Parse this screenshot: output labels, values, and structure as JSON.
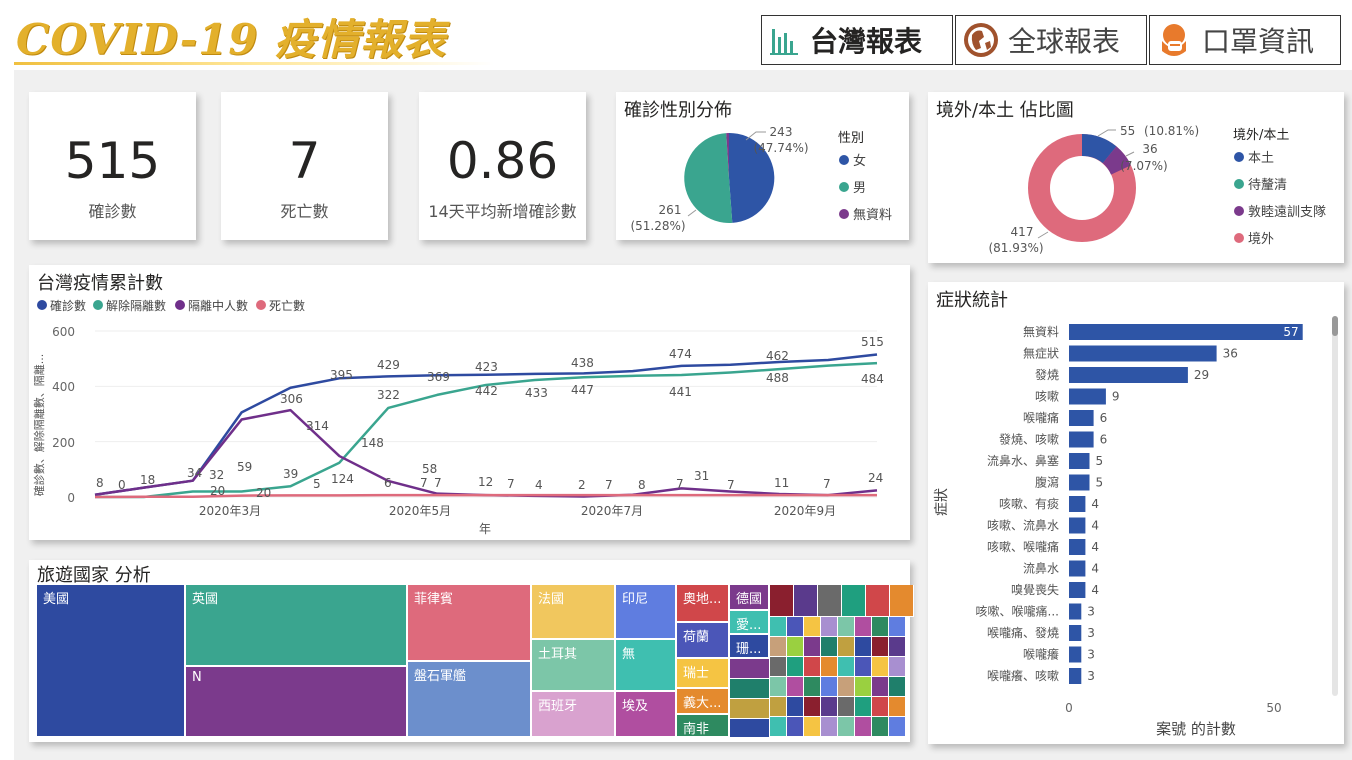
{
  "header": {
    "title": "COVID-19 疫情報表",
    "nav": [
      {
        "label": "台灣報表",
        "icon": "bar-chart-icon"
      },
      {
        "label": "全球報表",
        "icon": "globe-icon"
      },
      {
        "label": "口罩資訊",
        "icon": "mask-icon"
      }
    ]
  },
  "kpis": [
    {
      "value": "515",
      "label": "確診數"
    },
    {
      "value": "7",
      "label": "死亡數"
    },
    {
      "value": "0.86",
      "label": "14天平均新增確診數"
    }
  ],
  "gender_pie": {
    "title": "確診性別分佈",
    "legend_title": "性別",
    "legend": [
      {
        "name": "女",
        "color": "#2e55a6"
      },
      {
        "name": "男",
        "color": "#3aa58f"
      },
      {
        "name": "無資料",
        "color": "#7b3a8c"
      }
    ],
    "labels": [
      {
        "count": "243",
        "pct": "(47.74%)"
      },
      {
        "count": "261",
        "pct": "(51.28%)"
      }
    ]
  },
  "source_donut": {
    "title": "境外/本土 佔比圖",
    "legend_title": "境外/本土",
    "legend": [
      {
        "name": "本土",
        "color": "#2e55a6"
      },
      {
        "name": "待釐清",
        "color": "#3aa58f"
      },
      {
        "name": "敦睦遠訓支隊",
        "color": "#7b3a8c"
      },
      {
        "name": "境外",
        "color": "#de6a7c"
      }
    ],
    "labels": [
      {
        "count": "55",
        "pct": "(10.81%)"
      },
      {
        "count": "36",
        "pct": "(7.07%)"
      },
      {
        "count": "417",
        "pct": "(81.93%)"
      }
    ]
  },
  "line_chart": {
    "title": "台灣疫情累計數",
    "legend": [
      {
        "name": "確診數",
        "color": "#2e4aa0"
      },
      {
        "name": "解除隔離數",
        "color": "#3aa58f"
      },
      {
        "name": "隔離中人數",
        "color": "#6f2f8a"
      },
      {
        "name": "死亡數",
        "color": "#de6a7c"
      }
    ],
    "ylabel": "確診數、解除隔離數、隔離...",
    "xlabel": "年",
    "yticks": [
      "600",
      "400",
      "200",
      "0"
    ],
    "xticks": [
      "2020年3月",
      "2020年5月",
      "2020年7月",
      "2020年9月"
    ],
    "data_labels": [
      "8",
      "0",
      "18",
      "34",
      "32",
      "20",
      "59",
      "20",
      "306",
      "314",
      "39",
      "5",
      "395",
      "124",
      "322",
      "148",
      "429",
      "6",
      "7",
      "7",
      "58",
      "369",
      "423",
      "442",
      "12",
      "7",
      "433",
      "4",
      "438",
      "447",
      "2",
      "7",
      "8",
      "474",
      "441",
      "7",
      "31",
      "7",
      "462",
      "488",
      "11",
      "7",
      "515",
      "484",
      "24"
    ]
  },
  "chart_data": {
    "type": "line",
    "title": "台灣疫情累計數",
    "xlabel": "年",
    "ylabel": "確診數、解除隔離數、隔離...",
    "x": [
      "2020-01",
      "2020-02",
      "2020-03-01",
      "2020-03-15",
      "2020-04-01",
      "2020-04-15",
      "2020-05-01",
      "2020-05-15",
      "2020-06-01",
      "2020-06-15",
      "2020-07-01",
      "2020-07-15",
      "2020-08-01",
      "2020-08-15",
      "2020-09-01",
      "2020-09-15",
      "2020-10-01"
    ],
    "ylim": [
      0,
      600
    ],
    "series": [
      {
        "name": "確診數",
        "values": [
          8,
          34,
          59,
          306,
          395,
          429,
          436,
          440,
          442,
          445,
          447,
          455,
          474,
          478,
          488,
          495,
          515
        ]
      },
      {
        "name": "解除隔離數",
        "values": [
          0,
          0,
          20,
          20,
          39,
          124,
          322,
          369,
          405,
          423,
          433,
          438,
          441,
          450,
          462,
          475,
          484
        ]
      },
      {
        "name": "隔離中人數",
        "values": [
          8,
          34,
          59,
          280,
          314,
          148,
          58,
          12,
          7,
          4,
          2,
          8,
          31,
          20,
          11,
          7,
          24
        ]
      },
      {
        "name": "死亡數",
        "values": [
          0,
          1,
          1,
          5,
          6,
          6,
          7,
          7,
          7,
          7,
          7,
          7,
          7,
          7,
          7,
          7,
          7
        ]
      }
    ]
  },
  "symptoms": {
    "title": "症狀統計",
    "ylabel": "症狀",
    "xlabel": "案號 的計數",
    "xticks": [
      "0",
      "50"
    ],
    "items": [
      {
        "name": "無資料",
        "value": 57
      },
      {
        "name": "無症狀",
        "value": 36
      },
      {
        "name": "發燒",
        "value": 29
      },
      {
        "name": "咳嗽",
        "value": 9
      },
      {
        "name": "喉嚨痛",
        "value": 6
      },
      {
        "name": "發燒、咳嗽",
        "value": 6
      },
      {
        "name": "流鼻水、鼻塞",
        "value": 5
      },
      {
        "name": "腹瀉",
        "value": 5
      },
      {
        "name": "咳嗽、有痰",
        "value": 4
      },
      {
        "name": "咳嗽、流鼻水",
        "value": 4
      },
      {
        "name": "咳嗽、喉嚨痛",
        "value": 4
      },
      {
        "name": "流鼻水",
        "value": 4
      },
      {
        "name": "嗅覺喪失",
        "value": 4
      },
      {
        "name": "咳嗽、喉嚨痛...",
        "value": 3
      },
      {
        "name": "喉嚨痛、發燒",
        "value": 3
      },
      {
        "name": "喉嚨癢",
        "value": 3
      },
      {
        "name": "喉嚨癢、咳嗽",
        "value": 3
      }
    ]
  },
  "treemap": {
    "title": "旅遊國家 分析",
    "labels": [
      "美國",
      "英國",
      "N",
      "菲律賓",
      "盤石軍艦",
      "法國",
      "土耳其",
      "西班牙",
      "印尼",
      "無",
      "埃及",
      "奧地...",
      "荷蘭",
      "瑞士",
      "義大...",
      "南非",
      "德國",
      "愛...",
      "珊..."
    ]
  }
}
